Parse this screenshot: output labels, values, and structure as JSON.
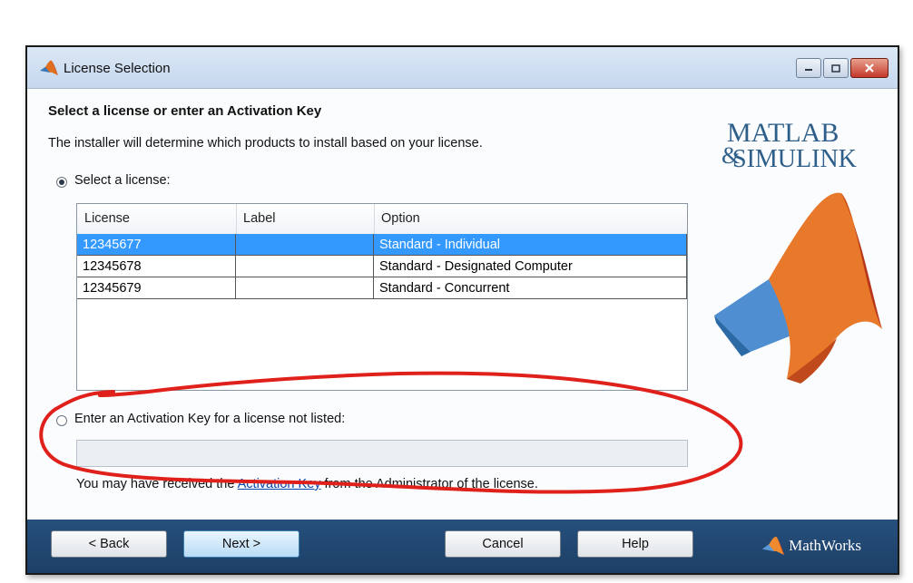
{
  "window": {
    "title": "License Selection"
  },
  "main": {
    "heading": "Select a license or enter an Activation Key",
    "subtext": "The installer will determine which products to install based on your license.",
    "select_license_label": "Select a license:",
    "table": {
      "columns": [
        "License",
        "Label",
        "Option"
      ],
      "rows": [
        {
          "license": "12345677",
          "label": "",
          "option": "Standard - Individual",
          "selected": true
        },
        {
          "license": "12345678",
          "label": "",
          "option": "Standard - Designated Computer",
          "selected": false
        },
        {
          "license": "12345679",
          "label": "",
          "option": "Standard - Concurrent",
          "selected": false
        }
      ]
    },
    "activation_label": "Enter an Activation Key for a license not listed:",
    "activation_value": "",
    "note_prefix": "You may have received the ",
    "note_link": "Activation Key",
    "note_suffix": " from the Administrator of the license.",
    "selected_option": "select-license"
  },
  "logo": {
    "line1": "MATLAB",
    "line2": "SIMULINK"
  },
  "footer": {
    "back": "< Back",
    "next": "Next >",
    "cancel": "Cancel",
    "help": "Help",
    "brand": "MathWorks"
  },
  "colors": {
    "footer": "#1f4670",
    "selection": "#3399ff",
    "annotation": "#e0211b"
  }
}
